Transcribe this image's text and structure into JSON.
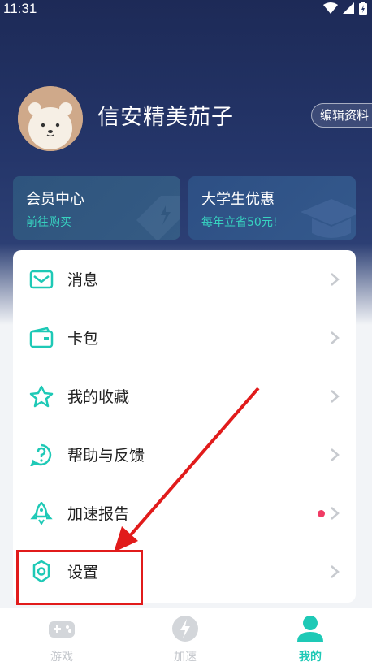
{
  "status_bar": {
    "time": "11:31"
  },
  "profile": {
    "username": "信安精美茄子",
    "edit_label": "编辑资料"
  },
  "promos": [
    {
      "title": "会员中心",
      "subtitle": "前往购买"
    },
    {
      "title": "大学生优惠",
      "subtitle": "每年立省50元!"
    }
  ],
  "menu": [
    {
      "label": "消息",
      "icon": "mail-icon"
    },
    {
      "label": "卡包",
      "icon": "wallet-icon"
    },
    {
      "label": "我的收藏",
      "icon": "star-icon"
    },
    {
      "label": "帮助与反馈",
      "icon": "help-icon"
    },
    {
      "label": "加速报告",
      "icon": "rocket-icon",
      "has_badge": true
    },
    {
      "label": "设置",
      "icon": "gear-icon"
    }
  ],
  "tabs": [
    {
      "label": "游戏",
      "icon": "gamepad-icon",
      "active": false
    },
    {
      "label": "加速",
      "icon": "bolt-icon",
      "active": false
    },
    {
      "label": "我的",
      "icon": "person-icon",
      "active": true
    }
  ],
  "colors": {
    "accent": "#1ec9b6",
    "badge": "#f03b64",
    "highlight": "#e11b1b"
  }
}
